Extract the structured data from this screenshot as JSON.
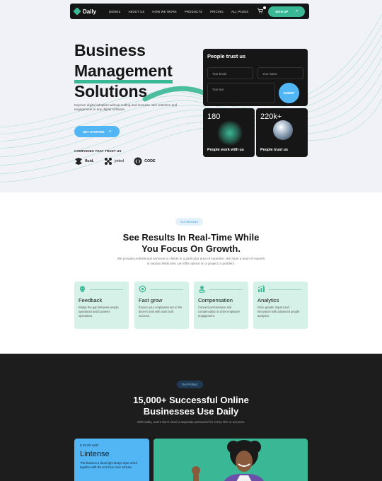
{
  "nav": {
    "brand": "Daily",
    "links": [
      "DEMOS",
      "ABOUT US",
      "HOW WE WORK",
      "PRODUCTS",
      "PRICING",
      "ALL PAGES"
    ],
    "signup": "SIGN UP",
    "signup_arrow": "↗"
  },
  "hero": {
    "title_line1": "Business",
    "title_line2": "Management",
    "title_line3": "Solutions",
    "subtitle": "Improve digital adoption without coding and increase user retention and engagement in any digital software.",
    "cta": "GET STARTED",
    "cta_arrow": "↗",
    "trust_label": "COMPANIES THAT TRUST US",
    "brands": [
      "fluid.",
      "jotted",
      "CODE"
    ]
  },
  "form": {
    "title": "People trust us",
    "email_placeholder": "Your Email",
    "name_placeholder": "Your Name",
    "text_placeholder": "Your text",
    "submit": "SUBMIT"
  },
  "stats": [
    {
      "number": "180",
      "label": "People work with us"
    },
    {
      "number": "220k+",
      "label": "People trust us"
    }
  ],
  "structure": {
    "pill": "Our Structure",
    "title_line1": "See Results In Real-Time While",
    "title_line2": "You Focus On Growth.",
    "description": "We provide professional services to clients in a particular area of expertise.  We have a team of experts in various fields who can offer advice on a project or problem.",
    "features": [
      {
        "title": "Feedback",
        "desc": "Bridge the gap between people operations and business operations.",
        "icon": "feedback-icon"
      },
      {
        "title": "Fast grow",
        "desc": "Ensure your employees are in the driver's seat with tools built success.",
        "icon": "growth-icon"
      },
      {
        "title": "Compensation",
        "desc": "Connect performance and compensation to drive employee engagement.",
        "icon": "compensation-icon"
      },
      {
        "title": "Analytics",
        "desc": "Drive greater impact and innovation with advanced people analytics.",
        "icon": "analytics-icon"
      }
    ]
  },
  "product": {
    "pill": "Our Product",
    "title_line1": "15,000+ Successful Online",
    "title_line2": "Businesses Use Daily",
    "description": "With Daily, users don't need a separate password for every site or account.",
    "card": {
      "price": "$ 48.00 USD",
      "name": "Lintense",
      "desc": "This features a clean light design style which together with the tech blue color scheme"
    }
  },
  "colors": {
    "accent_green": "#3ab795",
    "accent_blue": "#53b6f4",
    "dark": "#161616",
    "feature_bg": "#d6f1e7"
  }
}
